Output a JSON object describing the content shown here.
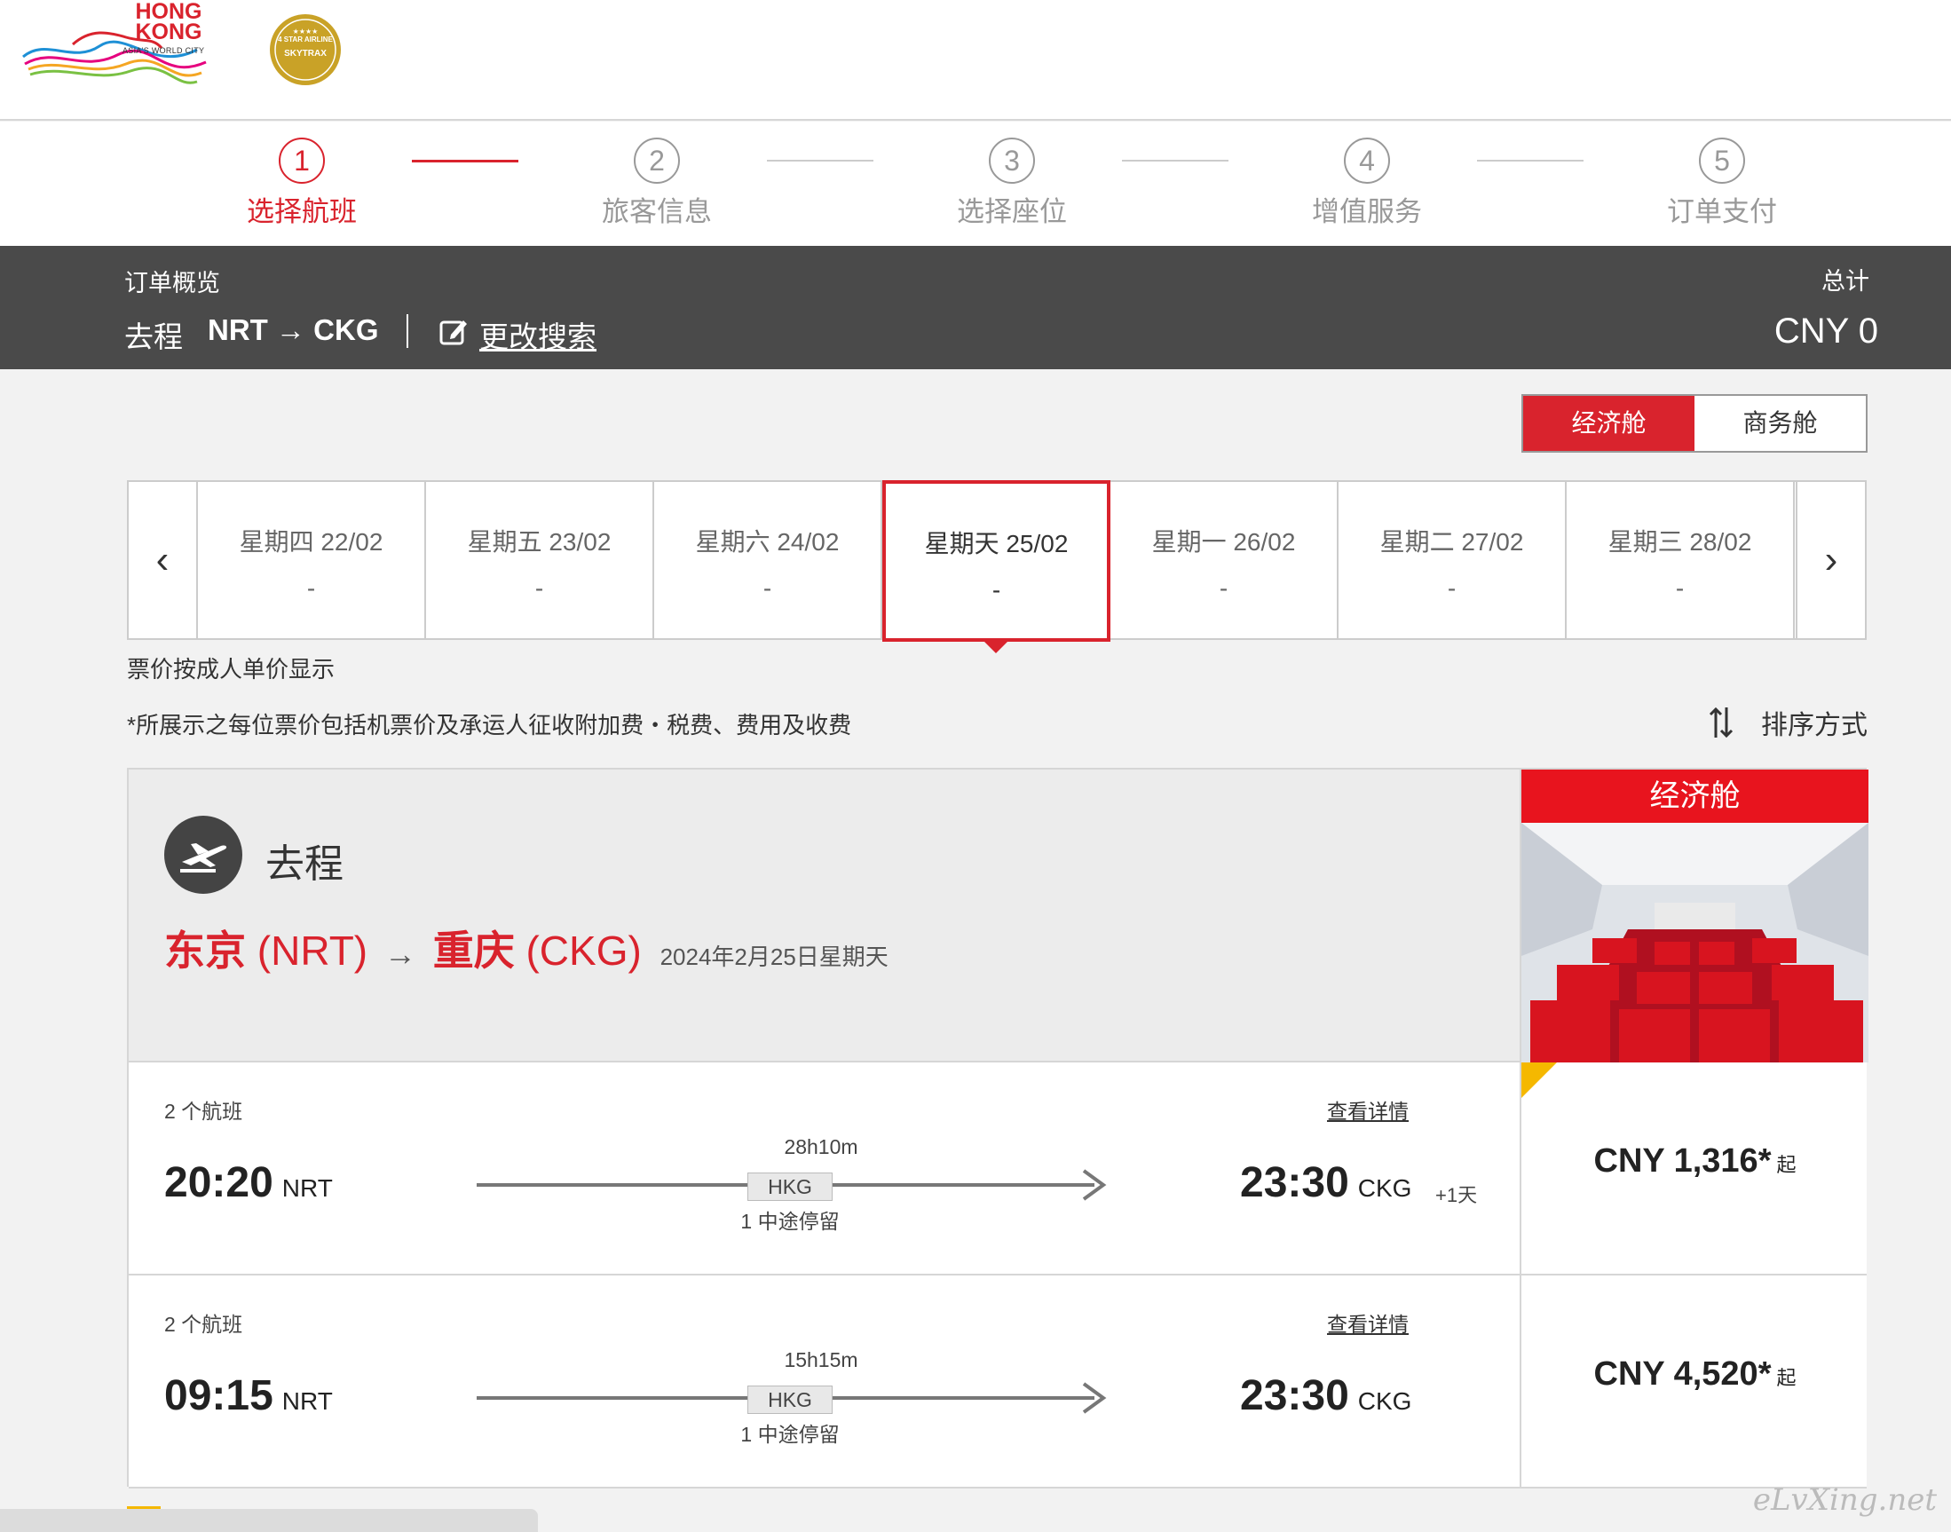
{
  "header": {
    "brand_line1": "HONG",
    "brand_line2": "KONG",
    "brand_sub": "ASIA'S WORLD CITY",
    "award_line1": "4 STAR AIRLINE",
    "award_line2": "SKYTRAX"
  },
  "steps": [
    {
      "num": "1",
      "label": "选择航班",
      "active": true
    },
    {
      "num": "2",
      "label": "旅客信息",
      "active": false
    },
    {
      "num": "3",
      "label": "选择座位",
      "active": false
    },
    {
      "num": "4",
      "label": "增值服务",
      "active": false
    },
    {
      "num": "5",
      "label": "订单支付",
      "active": false
    }
  ],
  "overview": {
    "label": "订单概览",
    "trip_type": "去程",
    "route": "NRT → CKG",
    "edit_label": "更改搜索",
    "total_label": "总计",
    "total_value": "CNY 0"
  },
  "cabin_toggle": {
    "economy": "经济舱",
    "business": "商务舱",
    "selected": "economy"
  },
  "dates": [
    {
      "day": "星期四 22/02",
      "price": "-"
    },
    {
      "day": "星期五 23/02",
      "price": "-"
    },
    {
      "day": "星期六 24/02",
      "price": "-"
    },
    {
      "day": "星期天 25/02",
      "price": "-",
      "selected": true
    },
    {
      "day": "星期一 26/02",
      "price": "-"
    },
    {
      "day": "星期二 27/02",
      "price": "-"
    },
    {
      "day": "星期三 28/02",
      "price": "-"
    }
  ],
  "notes": {
    "note1": "票价按成人单价显示",
    "note2": "*所展示之每位票价包括机票价及承运人征收附加费・税费、费用及收费",
    "sort_label": "排序方式"
  },
  "leg": {
    "title": "去程",
    "from_city": "东京",
    "from_code": "(NRT)",
    "to_city": "重庆",
    "to_code": "(CKG)",
    "date": "2024年2月25日星期天",
    "cabin_header": "经济舱"
  },
  "flights": [
    {
      "count": "2 个航班",
      "details": "查看详情",
      "dep_time": "20:20",
      "dep_code": "NRT",
      "arr_time": "23:30",
      "arr_code": "CKG",
      "plus_day": "+1天",
      "duration": "28h10m",
      "via": "HKG",
      "stops": "1 中途停留",
      "price": "CNY 1,316*",
      "from_label": "起"
    },
    {
      "count": "2 个航班",
      "details": "查看详情",
      "dep_time": "09:15",
      "dep_code": "NRT",
      "arr_time": "23:30",
      "arr_code": "CKG",
      "plus_day": "",
      "duration": "15h15m",
      "via": "HKG",
      "stops": "1 中途停留",
      "price": "CNY 4,520*",
      "from_label": "起"
    }
  ],
  "watermark": "eLvXing.net",
  "colors": {
    "accent": "#d9232d",
    "overview_bg": "#4a4a4a",
    "highlight": "#f5b800"
  }
}
